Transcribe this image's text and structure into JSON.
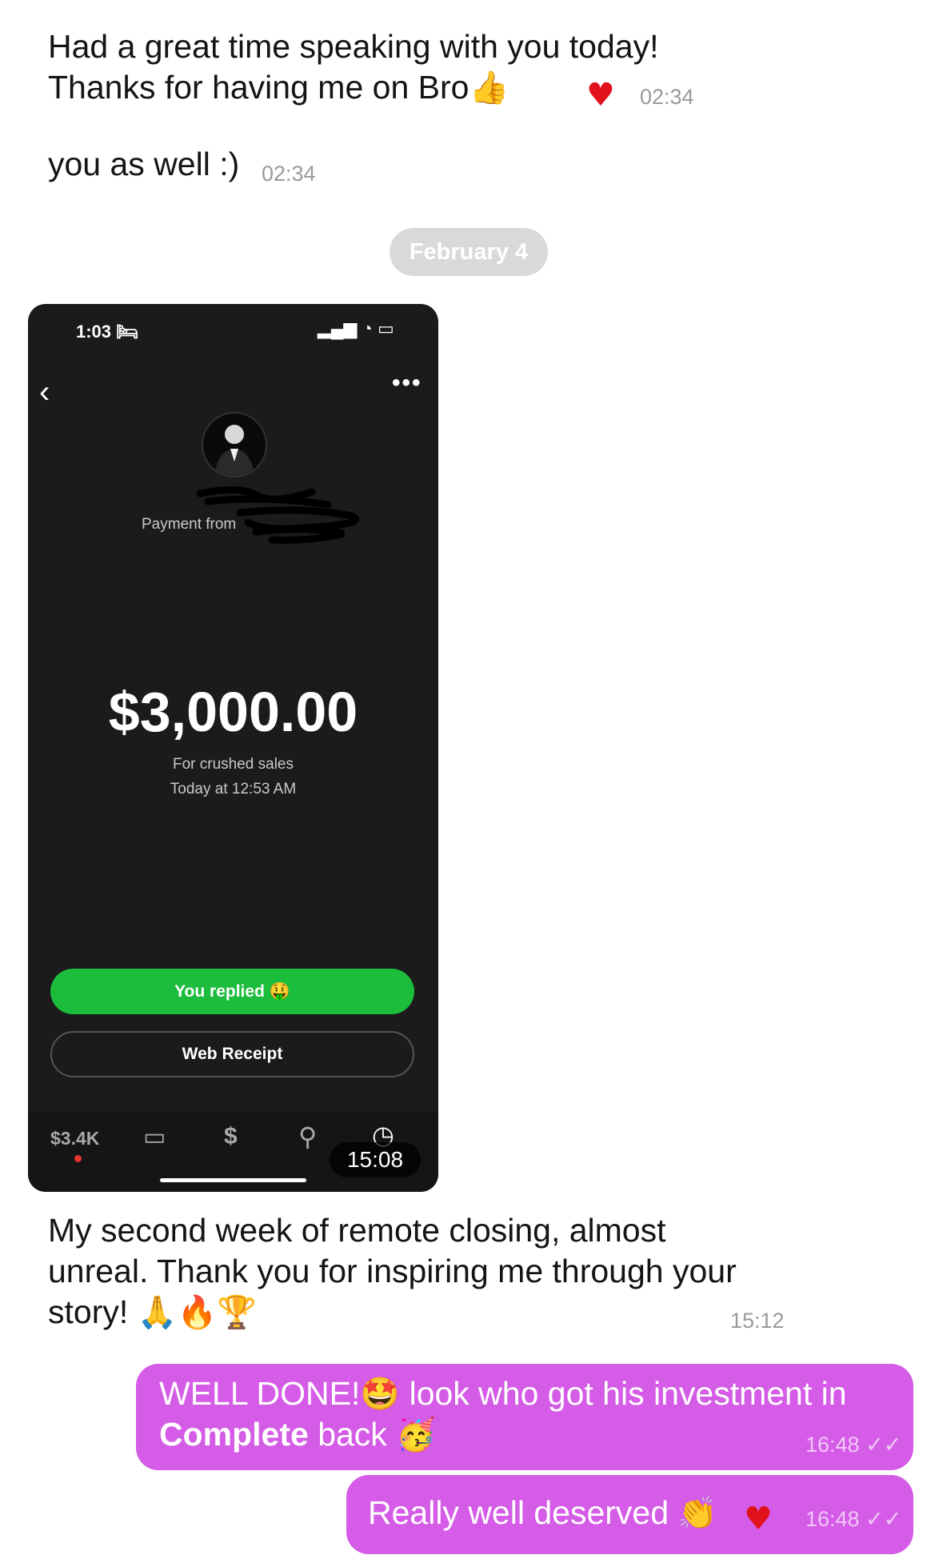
{
  "messages": {
    "m1": {
      "line1": "Had a great time speaking with you today!",
      "line2": "Thanks for having me on Bro",
      "emoji": "👍",
      "reaction": "♥",
      "time": "02:34"
    },
    "m2": {
      "text": "you as well :)",
      "time": "02:34"
    },
    "date_divider": "February 4",
    "m3": {
      "line1": "My second week of remote closing, almost",
      "line2": "unreal. Thank you for inspiring me through your",
      "line3": "story!",
      "emojis": "🙏🔥🏆",
      "time": "15:12"
    },
    "m4": {
      "line1_a": "WELL DONE!",
      "emoji1": "🤩",
      "line1_b": " look who got his investment in",
      "line2_bold": "Complete",
      "line2_rest": " back",
      "emoji2": "🥳",
      "time": "16:48",
      "ticks": "✓✓"
    },
    "m5": {
      "text": "Really well deserved",
      "emoji": "👏",
      "reaction": "♥",
      "time": "16:48",
      "ticks": "✓✓"
    }
  },
  "screenshot": {
    "status_time": "1:03",
    "status_icons": "▂▄▆ ◔ ▭",
    "back_icon": "‹",
    "more_icon": "•••",
    "payment_from": "Payment from",
    "amount": "$3,000.00",
    "note": "For crushed sales",
    "when": "Today at 12:53 AM",
    "replied_label": "You replied 🤑",
    "receipt_label": "Web Receipt",
    "tabs": {
      "balance": "$3.4K",
      "card": "▭",
      "dollar": "$",
      "search": "⚲",
      "activity": "◷"
    },
    "video_time": "15:08"
  },
  "colors": {
    "outgoing_bubble": "#d45ce6",
    "cash_green": "#1cbc3c",
    "heart": "#e0121b"
  }
}
